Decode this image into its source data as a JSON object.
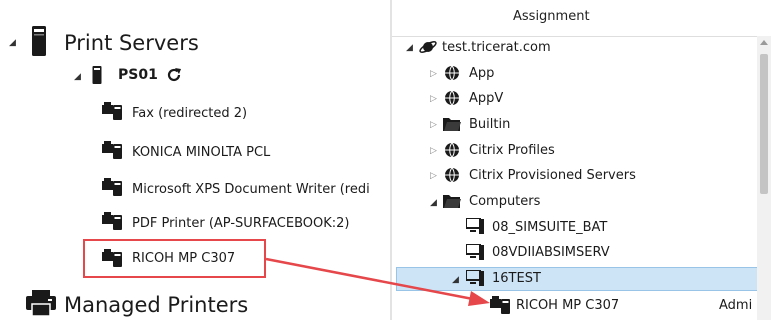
{
  "left": {
    "print_servers": "Print Servers",
    "server": "PS01",
    "printers": [
      "Fax (redirected 2)",
      "KONICA MINOLTA PCL",
      "Microsoft XPS Document Writer (redi",
      "PDF Printer (AP-SURFACEBOOK:2)",
      "RICOH MP C307"
    ],
    "managed_printers": "Managed Printers"
  },
  "right": {
    "header": "Assignment",
    "domain": "test.tricerat.com",
    "ous": [
      "App",
      "AppV",
      "Builtin",
      "Citrix Profiles",
      "Citrix Provisioned Servers",
      "Computers"
    ],
    "computers": [
      "08_SIMSUITE_BAT",
      "08VDIIABSIMSERV",
      "16TEST"
    ],
    "assigned_printer": "RICOH MP C307",
    "truncated_col": "Admi"
  },
  "colors": {
    "highlight": "#e5474a",
    "selection": "#cde4f7"
  }
}
